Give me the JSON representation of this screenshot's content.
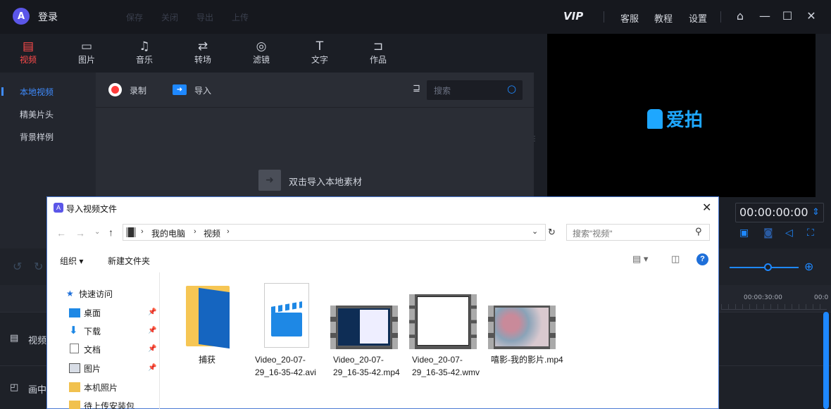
{
  "titlebar": {
    "login": "登录",
    "menu": [
      "保存",
      "关闭",
      "导出",
      "上传"
    ],
    "vip": "VIP",
    "links": [
      "客服",
      "教程",
      "设置"
    ]
  },
  "tools": [
    {
      "label": "视频",
      "icon": "video-icon",
      "active": true
    },
    {
      "label": "图片",
      "icon": "image-icon"
    },
    {
      "label": "音乐",
      "icon": "music-icon"
    },
    {
      "label": "转场",
      "icon": "transition-icon"
    },
    {
      "label": "滤镜",
      "icon": "filter-icon"
    },
    {
      "label": "文字",
      "icon": "text-icon"
    },
    {
      "label": "作品",
      "icon": "folder-icon"
    }
  ],
  "leftnav": [
    "本地视频",
    "精美片头",
    "背景样例"
  ],
  "content": {
    "record": "录制",
    "import": "导入",
    "search_placeholder": "搜索",
    "empty_hint": "双击导入本地素材"
  },
  "preview": {
    "brand": "爱拍",
    "timecode": "00:00:00:00"
  },
  "timeline": {
    "ticks": [
      "00:00:30:00",
      "00:0"
    ],
    "tracks": [
      "视频",
      "画中"
    ]
  },
  "dialog": {
    "title": "导入视频文件",
    "path": [
      "我的电脑",
      "视频"
    ],
    "search_placeholder": "搜索\"视频\"",
    "organize": "组织 ▾",
    "new_folder": "新建文件夹",
    "nav": [
      {
        "label": "快速访问",
        "icon": "star-icon"
      },
      {
        "label": "桌面",
        "icon": "desktop-icon"
      },
      {
        "label": "下载",
        "icon": "download-icon"
      },
      {
        "label": "文档",
        "icon": "document-icon"
      },
      {
        "label": "图片",
        "icon": "pictures-icon"
      },
      {
        "label": "本机照片",
        "icon": "folder-icon"
      },
      {
        "label": "待上传安装包",
        "icon": "folder-icon"
      }
    ],
    "files": [
      {
        "name": "捕获",
        "kind": "folder"
      },
      {
        "name": "Video_20-07-29_16-35-42.avi",
        "kind": "clapper"
      },
      {
        "name": "Video_20-07-29_16-35-42.mp4",
        "kind": "video-screen"
      },
      {
        "name": "Video_20-07-29_16-35-42.wmv",
        "kind": "video-blank"
      },
      {
        "name": "嘻影-我的影片.mp4",
        "kind": "video-flowers"
      }
    ]
  }
}
